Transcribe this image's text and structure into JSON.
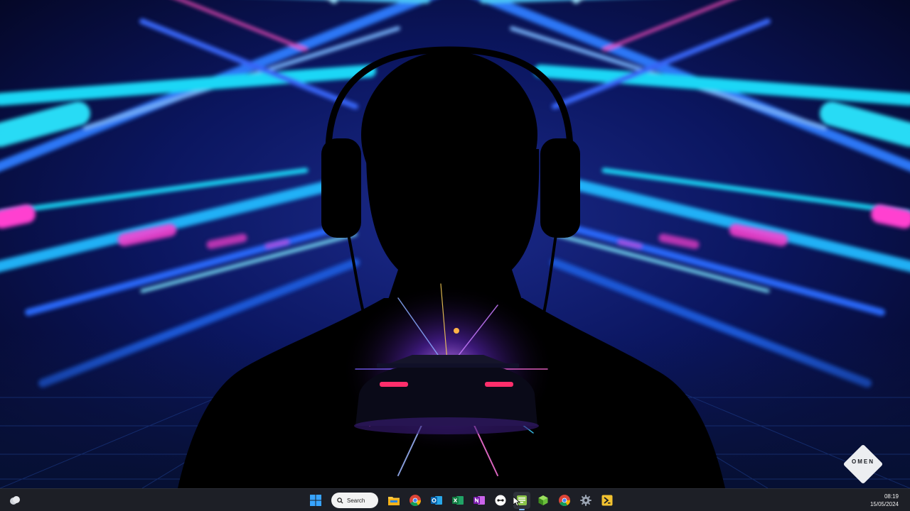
{
  "wallpaper": {
    "logo_text": "OMEN"
  },
  "taskbar": {
    "search_label": "Search",
    "time": "08:19",
    "date": "15/05/2024",
    "pinned_apps": [
      "start",
      "search",
      "file-explorer",
      "chrome",
      "outlook",
      "excel",
      "onenote",
      "app-circle",
      "notepad-plus",
      "app-green-cube",
      "chrome",
      "settings",
      "app-yellow"
    ]
  },
  "colors": {
    "taskbar_bg": "#1d1f26",
    "accent": "#7fb9ff",
    "neon_blue": "#27b6ff",
    "neon_pink": "#ff3fd0"
  }
}
